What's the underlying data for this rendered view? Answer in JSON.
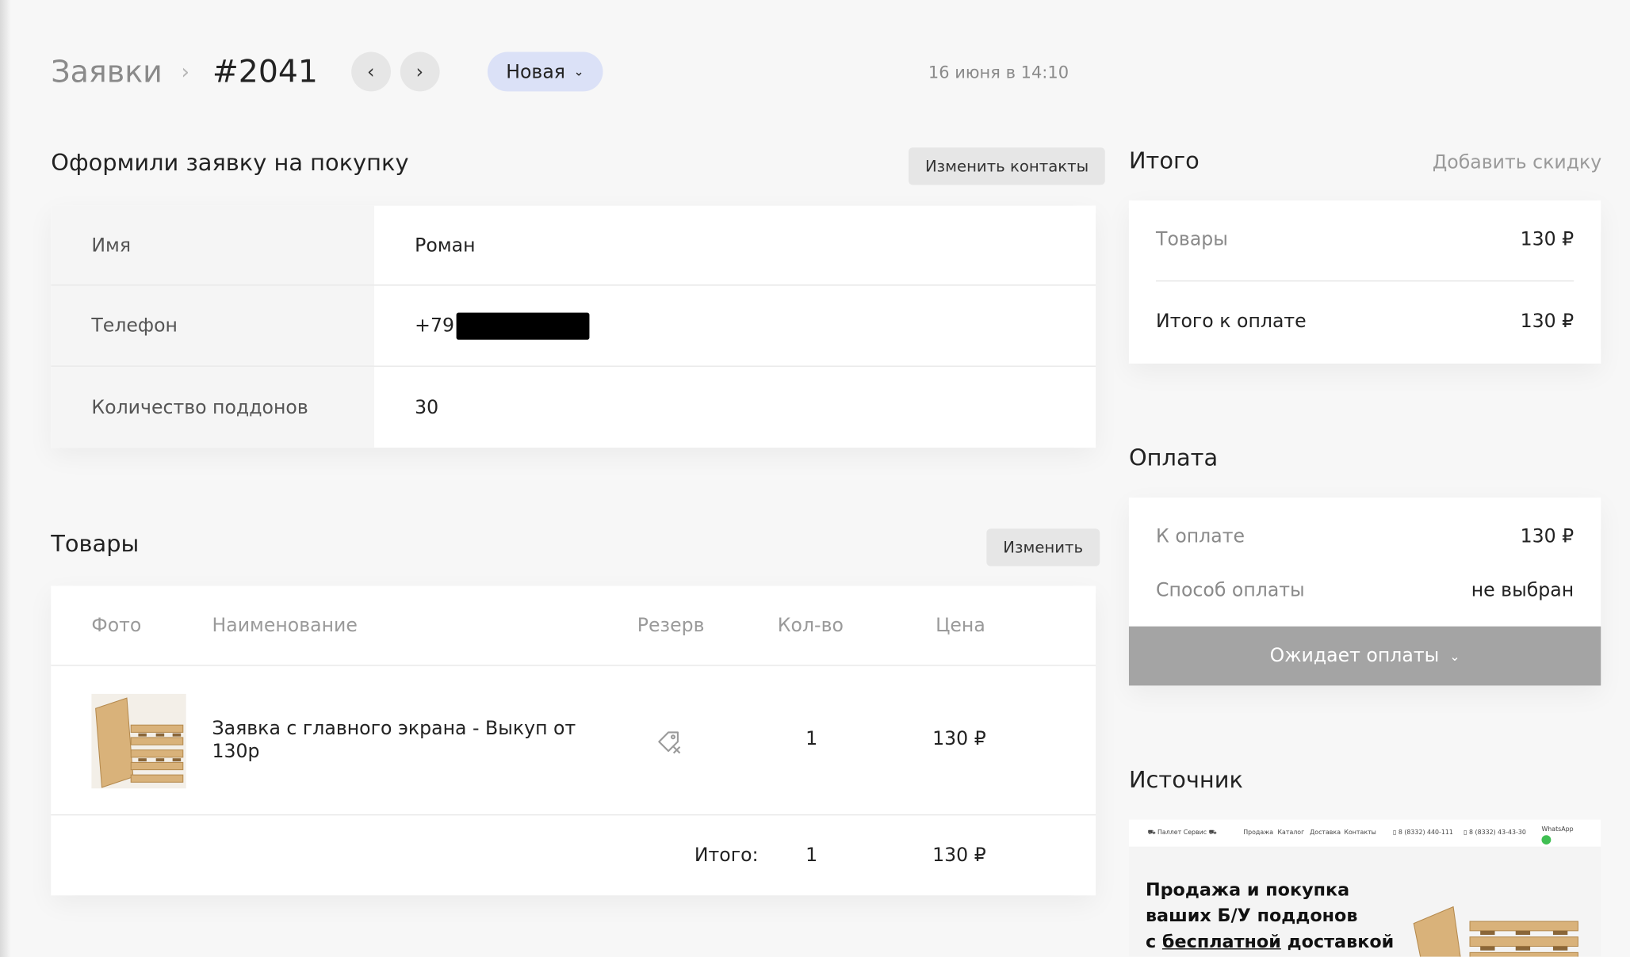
{
  "header": {
    "breadcrumb_root": "Заявки",
    "breadcrumb_sep": "›",
    "order_number": "#2041",
    "prev_icon": "‹",
    "next_icon": "›",
    "status": "Новая",
    "status_chevron": "⌄",
    "date": "16 июня в 14:10"
  },
  "contacts": {
    "title": "Оформили заявку на покупку",
    "edit_button": "Изменить контакты",
    "rows": [
      {
        "label": "Имя",
        "value": "Роман"
      },
      {
        "label": "Телефон",
        "value": "+79"
      },
      {
        "label": "Количество поддонов",
        "value": "30"
      }
    ]
  },
  "goods": {
    "title": "Товары",
    "edit_button": "Изменить",
    "columns": [
      "Фото",
      "Наименование",
      "Резерв",
      "Кол-во",
      "Цена"
    ],
    "items": [
      {
        "name": "Заявка с главного экрана - Выкуп от 130р",
        "qty": "1",
        "price": "130 ₽",
        "reserve_icon": "tag-off-icon"
      }
    ],
    "footer": {
      "label": "Итого:",
      "qty": "1",
      "price": "130 ₽"
    }
  },
  "totals": {
    "title": "Итого",
    "add_discount": "Добавить скидку",
    "goods_label": "Товары",
    "goods_value": "130 ₽",
    "total_label": "Итого к оплате",
    "total_value": "130 ₽"
  },
  "payment": {
    "title": "Оплата",
    "due_label": "К оплате",
    "due_value": "130 ₽",
    "method_label": "Способ оплаты",
    "method_value": "не выбран",
    "status_button": "Ожидает оплаты",
    "status_chevron": "⌄"
  },
  "source": {
    "title": "Источник",
    "preview": {
      "brand": "Паллет Сервис",
      "nav": [
        "Продажа",
        "Каталог",
        "Доставка",
        "Контакты"
      ],
      "phone1": "8 (8332) 440-111",
      "phone2": "8 (8332) 43-43-30",
      "whatsapp": "WhatsApp",
      "headline_1": "Продажа и покупка",
      "headline_2": "ваших Б/У поддонов",
      "headline_3_pre": "с ",
      "headline_3_link": "бесплатной",
      "headline_3_post": " доставкой"
    }
  },
  "colors": {
    "status_pill": "#dbe1f7",
    "pay_button": "#a4a4a4",
    "muted_text": "#8a8a8a"
  }
}
